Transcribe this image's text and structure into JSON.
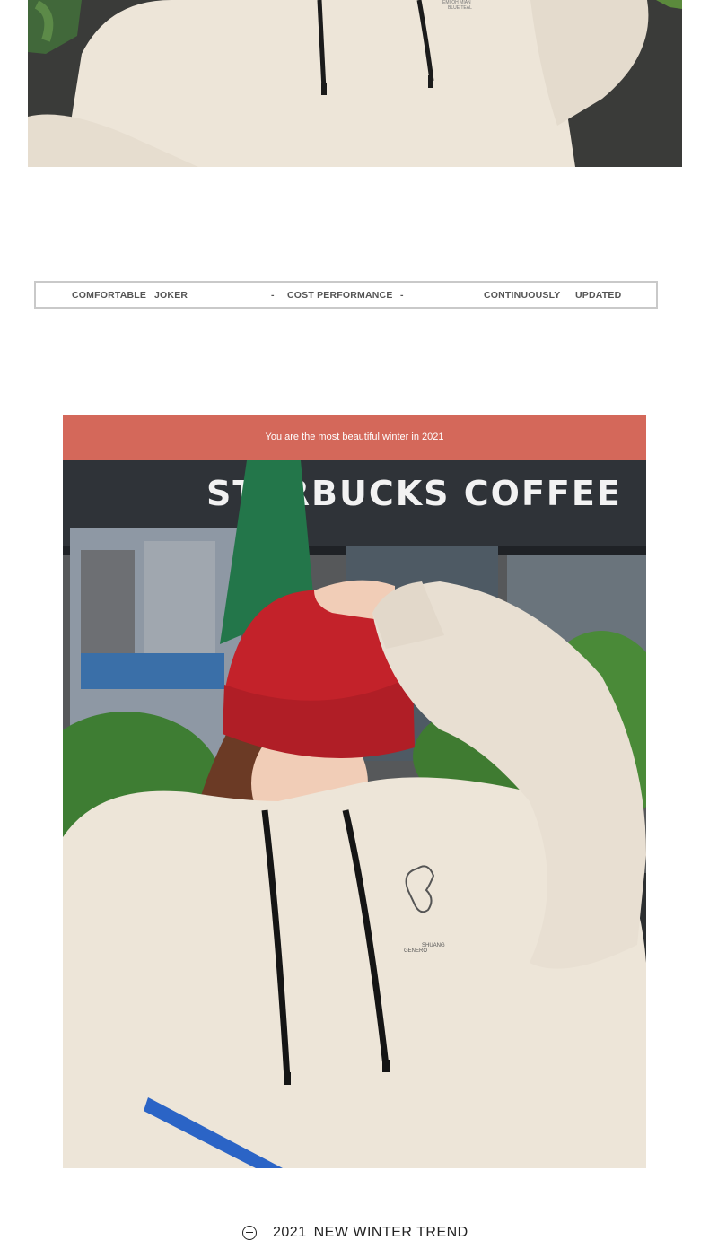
{
  "top_photo": {
    "print_text_1": "EMIIOH MIAN",
    "print_text_2": "BLUE TEAL"
  },
  "features": {
    "item1_a": "COMFORTABLE",
    "item1_b": "JOKER",
    "sep1": "-",
    "item2": "COST PERFORMANCE",
    "sep2": "-",
    "item3_a": "CONTINUOUSLY",
    "item3_b": "UPDATED"
  },
  "banner": {
    "text": "You are the most beautiful winter in 2021",
    "color": "#d4685a"
  },
  "main_photo": {
    "store_sign": "STARBUCKS COFFEE",
    "hoodie_print_1": "GENERO",
    "hoodie_print_2": "SHUANG"
  },
  "footer": {
    "icon": "plus-circle-icon",
    "year": "2021",
    "title": "NEW WINTER TREND"
  }
}
